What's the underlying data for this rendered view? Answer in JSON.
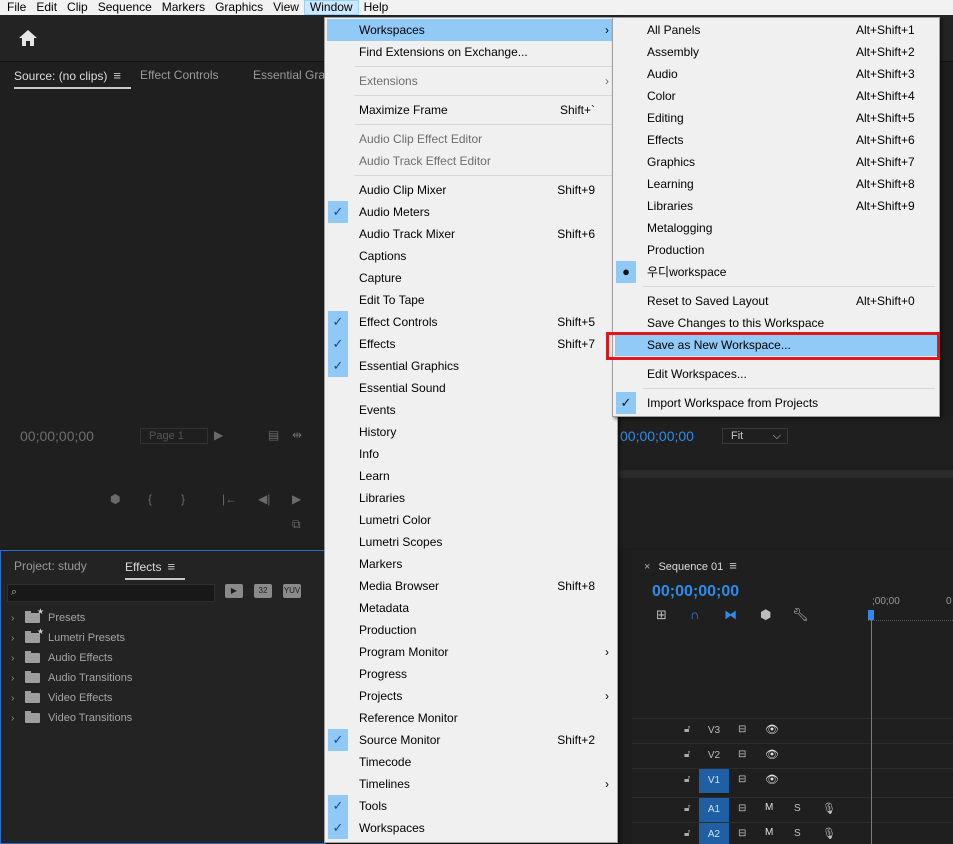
{
  "menubar": [
    "File",
    "Edit",
    "Clip",
    "Sequence",
    "Markers",
    "Graphics",
    "View",
    "Window",
    "Help"
  ],
  "source_panel": {
    "tabs": [
      "Source: (no clips)",
      "Effect Controls",
      "Essential Grap"
    ],
    "timecode": "00;00;00;00",
    "page_select": "Page 1"
  },
  "program_panel": {
    "timecode": "00;00;00;00",
    "zoom_select": "Fit"
  },
  "effects_panel": {
    "tabs": [
      "Project: study",
      "Effects"
    ],
    "buttons": [
      "32",
      "YUV"
    ],
    "tree": [
      "Presets",
      "Lumetri Presets",
      "Audio Effects",
      "Audio Transitions",
      "Video Effects",
      "Video Transitions"
    ]
  },
  "timeline_panel": {
    "sequence_tab": "Sequence 01",
    "timecode": "00;00;00;00",
    "ruler_start": ";00;00",
    "ruler_next": "0",
    "tracks": [
      "V3",
      "V2",
      "V1",
      "A1",
      "A2"
    ],
    "track_buttons": {
      "mute": "M",
      "solo": "S"
    }
  },
  "window_menu": {
    "items": [
      {
        "label": "Workspaces",
        "shortcut": "",
        "checked": false,
        "submenu": true,
        "disabled": false,
        "highlighted": true
      },
      {
        "label": "Find Extensions on Exchange...",
        "shortcut": "",
        "checked": false,
        "submenu": false,
        "disabled": false
      },
      {
        "label": "Extensions",
        "shortcut": "",
        "checked": false,
        "submenu": true,
        "disabled": true
      },
      {
        "label": "Maximize Frame",
        "shortcut": "Shift+`",
        "checked": false,
        "submenu": false,
        "disabled": false
      },
      {
        "label": "Audio Clip Effect Editor",
        "shortcut": "",
        "checked": false,
        "submenu": false,
        "disabled": true
      },
      {
        "label": "Audio Track Effect Editor",
        "shortcut": "",
        "checked": false,
        "submenu": false,
        "disabled": true
      },
      {
        "label": "Audio Clip Mixer",
        "shortcut": "Shift+9",
        "checked": false,
        "submenu": false,
        "disabled": false
      },
      {
        "label": "Audio Meters",
        "shortcut": "",
        "checked": true,
        "submenu": false,
        "disabled": false
      },
      {
        "label": "Audio Track Mixer",
        "shortcut": "Shift+6",
        "checked": false,
        "submenu": false,
        "disabled": false
      },
      {
        "label": "Captions",
        "shortcut": "",
        "checked": false,
        "submenu": false,
        "disabled": false
      },
      {
        "label": "Capture",
        "shortcut": "",
        "checked": false,
        "submenu": false,
        "disabled": false
      },
      {
        "label": "Edit To Tape",
        "shortcut": "",
        "checked": false,
        "submenu": false,
        "disabled": false
      },
      {
        "label": "Effect Controls",
        "shortcut": "Shift+5",
        "checked": true,
        "submenu": false,
        "disabled": false
      },
      {
        "label": "Effects",
        "shortcut": "Shift+7",
        "checked": true,
        "submenu": false,
        "disabled": false
      },
      {
        "label": "Essential Graphics",
        "shortcut": "",
        "checked": true,
        "submenu": false,
        "disabled": false
      },
      {
        "label": "Essential Sound",
        "shortcut": "",
        "checked": false,
        "submenu": false,
        "disabled": false
      },
      {
        "label": "Events",
        "shortcut": "",
        "checked": false,
        "submenu": false,
        "disabled": false
      },
      {
        "label": "History",
        "shortcut": "",
        "checked": false,
        "submenu": false,
        "disabled": false
      },
      {
        "label": "Info",
        "shortcut": "",
        "checked": false,
        "submenu": false,
        "disabled": false
      },
      {
        "label": "Learn",
        "shortcut": "",
        "checked": false,
        "submenu": false,
        "disabled": false
      },
      {
        "label": "Libraries",
        "shortcut": "",
        "checked": false,
        "submenu": false,
        "disabled": false
      },
      {
        "label": "Lumetri Color",
        "shortcut": "",
        "checked": false,
        "submenu": false,
        "disabled": false
      },
      {
        "label": "Lumetri Scopes",
        "shortcut": "",
        "checked": false,
        "submenu": false,
        "disabled": false
      },
      {
        "label": "Markers",
        "shortcut": "",
        "checked": false,
        "submenu": false,
        "disabled": false
      },
      {
        "label": "Media Browser",
        "shortcut": "Shift+8",
        "checked": false,
        "submenu": false,
        "disabled": false
      },
      {
        "label": "Metadata",
        "shortcut": "",
        "checked": false,
        "submenu": false,
        "disabled": false
      },
      {
        "label": "Production",
        "shortcut": "",
        "checked": false,
        "submenu": false,
        "disabled": false
      },
      {
        "label": "Program Monitor",
        "shortcut": "",
        "checked": false,
        "submenu": true,
        "disabled": false
      },
      {
        "label": "Progress",
        "shortcut": "",
        "checked": false,
        "submenu": false,
        "disabled": false
      },
      {
        "label": "Projects",
        "shortcut": "",
        "checked": false,
        "submenu": true,
        "disabled": false
      },
      {
        "label": "Reference Monitor",
        "shortcut": "",
        "checked": false,
        "submenu": false,
        "disabled": false
      },
      {
        "label": "Source Monitor",
        "shortcut": "Shift+2",
        "checked": true,
        "submenu": false,
        "disabled": false
      },
      {
        "label": "Timecode",
        "shortcut": "",
        "checked": false,
        "submenu": false,
        "disabled": false
      },
      {
        "label": "Timelines",
        "shortcut": "",
        "checked": false,
        "submenu": true,
        "disabled": false
      },
      {
        "label": "Tools",
        "shortcut": "",
        "checked": true,
        "submenu": false,
        "disabled": false
      },
      {
        "label": "Workspaces",
        "shortcut": "",
        "checked": true,
        "submenu": false,
        "disabled": false
      }
    ]
  },
  "workspaces_menu": {
    "items": [
      {
        "label": "All Panels",
        "shortcut": "Alt+Shift+1",
        "mark": ""
      },
      {
        "label": "Assembly",
        "shortcut": "Alt+Shift+2",
        "mark": ""
      },
      {
        "label": "Audio",
        "shortcut": "Alt+Shift+3",
        "mark": ""
      },
      {
        "label": "Color",
        "shortcut": "Alt+Shift+4",
        "mark": ""
      },
      {
        "label": "Editing",
        "shortcut": "Alt+Shift+5",
        "mark": ""
      },
      {
        "label": "Effects",
        "shortcut": "Alt+Shift+6",
        "mark": ""
      },
      {
        "label": "Graphics",
        "shortcut": "Alt+Shift+7",
        "mark": ""
      },
      {
        "label": "Learning",
        "shortcut": "Alt+Shift+8",
        "mark": ""
      },
      {
        "label": "Libraries",
        "shortcut": "Alt+Shift+9",
        "mark": ""
      },
      {
        "label": "Metalogging",
        "shortcut": "",
        "mark": ""
      },
      {
        "label": "Production",
        "shortcut": "",
        "mark": ""
      },
      {
        "label": "우디workspace",
        "shortcut": "",
        "mark": "dot"
      },
      {
        "label": "Reset to Saved Layout",
        "shortcut": "Alt+Shift+0",
        "mark": ""
      },
      {
        "label": "Save Changes to this Workspace",
        "shortcut": "",
        "mark": ""
      },
      {
        "label": "Save as New Workspace...",
        "shortcut": "",
        "mark": "",
        "highlighted": true
      },
      {
        "label": "Edit Workspaces...",
        "shortcut": "",
        "mark": ""
      },
      {
        "label": "Import Workspace from Projects",
        "shortcut": "",
        "mark": "check"
      }
    ]
  },
  "colors": {
    "accent": "#2d8ceb",
    "menu_bg": "#f0f0f0",
    "menu_highlight": "#91c9f7",
    "callout": "#e0161b"
  }
}
